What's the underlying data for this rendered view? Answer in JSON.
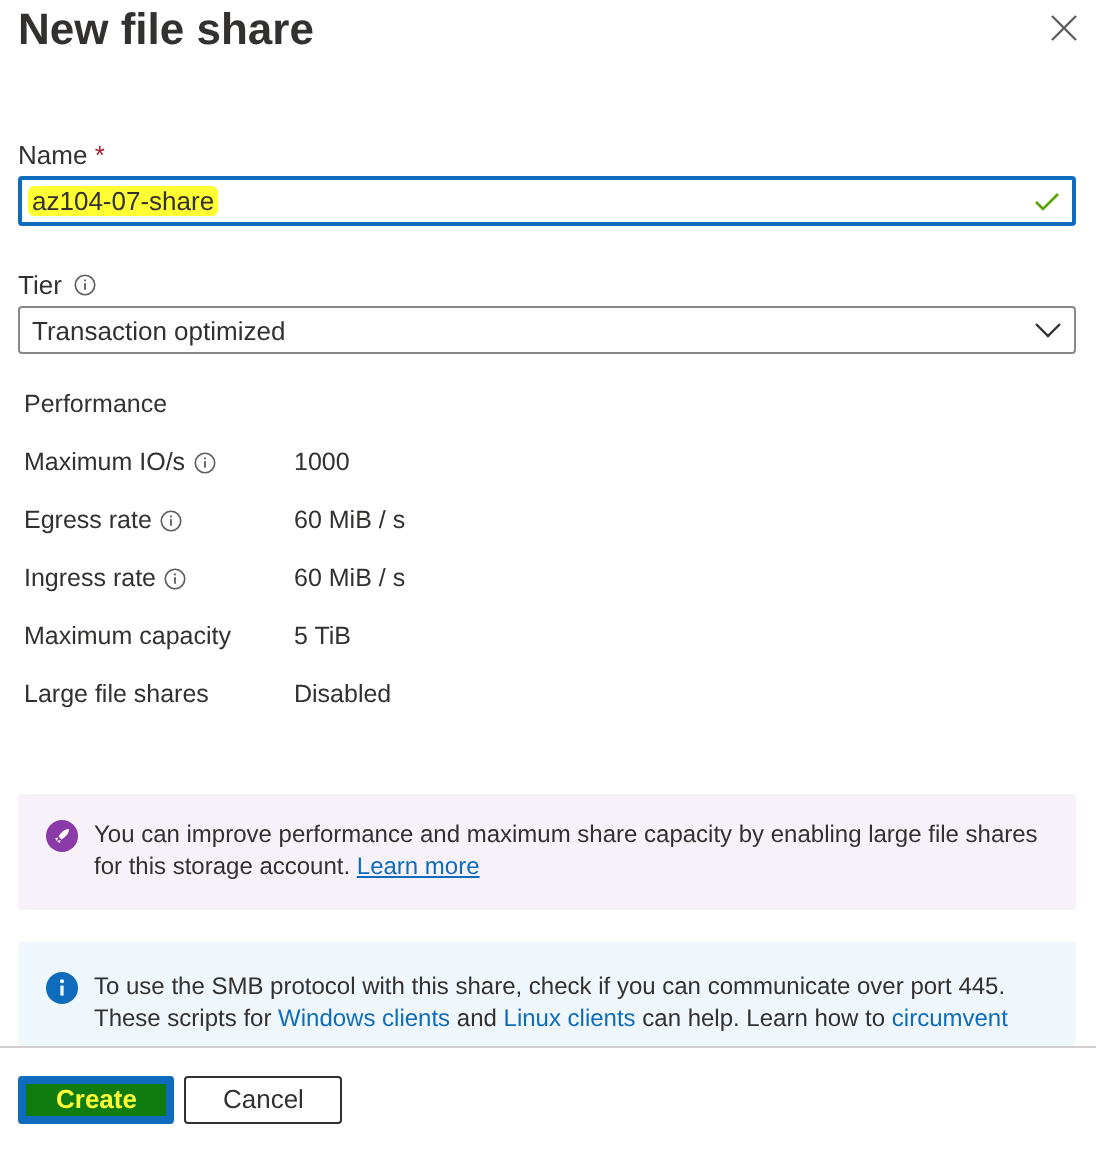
{
  "title": "New file share",
  "name_field": {
    "label": "Name",
    "required_mark": "*",
    "value": "az104-07-share",
    "valid": true,
    "highlighted": true
  },
  "tier_field": {
    "label": "Tier",
    "info": true,
    "value": "Transaction optimized"
  },
  "performance": {
    "heading": "Performance",
    "rows": [
      {
        "label": "Maximum IO/s",
        "info": true,
        "value": "1000"
      },
      {
        "label": "Egress rate",
        "info": true,
        "value": "60 MiB / s"
      },
      {
        "label": "Ingress rate",
        "info": true,
        "value": "60 MiB / s"
      },
      {
        "label": "Maximum capacity",
        "info": false,
        "value": "5 TiB"
      },
      {
        "label": "Large file shares",
        "info": false,
        "value": "Disabled"
      }
    ]
  },
  "notices": [
    {
      "kind": "tip",
      "segments": [
        {
          "text": "You can improve performance and maximum share capacity by enabling large file shares for this storage account. "
        },
        {
          "link": "Learn more"
        }
      ]
    },
    {
      "kind": "info",
      "segments": [
        {
          "text": "To use the SMB protocol with this share, check if you can communicate over port 445. These scripts for "
        },
        {
          "link": "Windows clients"
        },
        {
          "text": " and "
        },
        {
          "link": "Linux clients"
        },
        {
          "text": " can help. Learn how to "
        },
        {
          "link": "circumvent"
        }
      ]
    }
  ],
  "buttons": [
    {
      "label": "Create",
      "kind": "primary",
      "highlighted": true
    },
    {
      "label": "Cancel",
      "kind": "secondary",
      "highlighted": false
    }
  ]
}
